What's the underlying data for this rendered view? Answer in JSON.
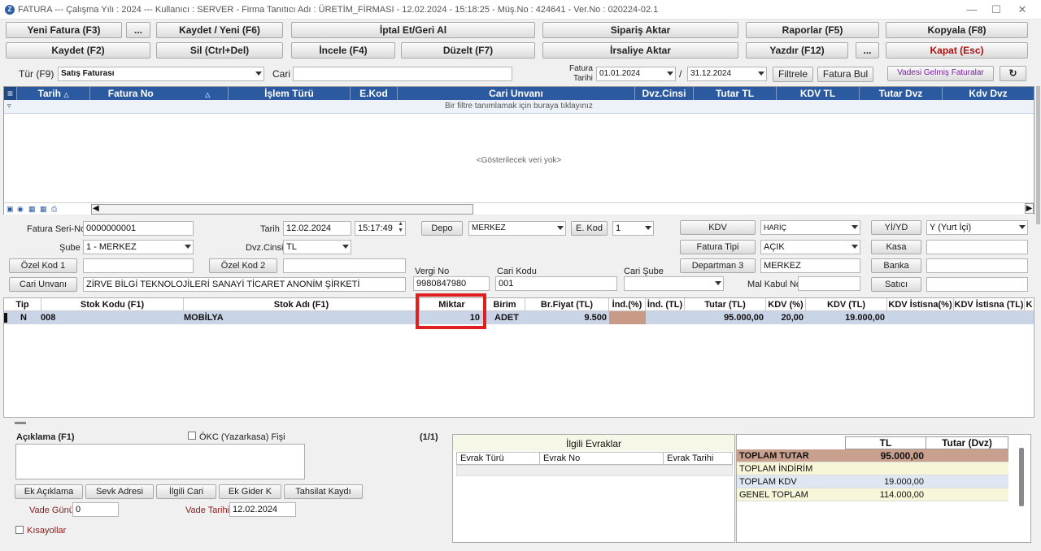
{
  "window": {
    "title": "FATURA  ---  Çalışma Yılı : 2024  ---  Kullanıcı : SERVER - Firma Tanıtıcı Adı : ÜRETİM_FİRMASI - 12.02.2024 - 15:18:25 - Müş.No : 424641 - Ver.No : 020224-02.1",
    "app_icon_letter": "Z"
  },
  "toolbar": {
    "yeni_fatura": "Yeni Fatura (F3)",
    "ellipsis1": "...",
    "kaydet_yeni": "Kaydet / Yeni (F6)",
    "iptal": "İptal Et/Geri Al",
    "siparis_aktar": "Sipariş Aktar",
    "raporlar": "Raporlar (F5)",
    "kopyala": "Kopyala (F8)",
    "kaydet": "Kaydet (F2)",
    "sil": "Sil (Ctrl+Del)",
    "incele": "İncele (F4)",
    "duzelt": "Düzelt (F7)",
    "irsaliye_aktar": "İrsaliye Aktar",
    "yazdir": "Yazdır (F12)",
    "ellipsis2": "...",
    "kapat": "Kapat (Esc)"
  },
  "filter": {
    "tur_label": "Tür (F9)",
    "tur_value": "Satış Faturası",
    "cari_label": "Cari",
    "cari_value": "",
    "fatura_tarihi_label1": "Fatura",
    "fatura_tarihi_label2": "Tarihi",
    "date_from": "01.01.2024",
    "date_sep": "/",
    "date_to": "31.12.2024",
    "filtrele": "Filtrele",
    "fatura_bul": "Fatura Bul",
    "vadesi_gelmis": "Vadesi Gelmiş Faturalar",
    "refresh_icon": "refresh-icon"
  },
  "invoice_grid": {
    "columns": [
      "Tarih",
      "Fatura No",
      "İşlem Türü",
      "E.Kod",
      "Cari Unvanı",
      "Dvz.Cinsi",
      "Tutar TL",
      "KDV TL",
      "Tutar Dvz",
      "Kdv Dvz"
    ],
    "filter_hint": "Bir filtre tanımlamak için buraya tıklayınız",
    "empty_text": "<Gösterilecek veri yok>"
  },
  "form": {
    "fatura_seri_no_label": "Fatura Seri-No",
    "fatura_seri_no": "0000000001",
    "tarih_label": "Tarih",
    "tarih": "12.02.2024",
    "saat": "15:17:49",
    "depo_btn": "Depo",
    "depo_value": "MERKEZ",
    "ekod_btn": "E. Kod",
    "ekod_value": "1",
    "kdv_btn": "KDV",
    "kdv_value": "HARİÇ",
    "yiyd_btn": "Yİ/YD",
    "yiyd_value": "Y (Yurt İçi)",
    "sube_label": "Şube",
    "sube_value": "1 - MERKEZ",
    "dvz_label": "Dvz.Cinsi",
    "dvz_value": "TL",
    "fatura_tipi_btn": "Fatura Tipi",
    "fatura_tipi_value": "AÇIK",
    "kasa_btn": "Kasa",
    "kasa_value": "",
    "ozel_kod1_btn": "Özel Kod 1",
    "ozel_kod1_value": "",
    "ozel_kod2_btn": "Özel Kod 2",
    "ozel_kod2_value": "",
    "departman_btn": "Departman 3",
    "departman_value": "MERKEZ",
    "banka_btn": "Banka",
    "banka_value": "",
    "vergi_no_label": "Vergi No",
    "vergi_no": "9980847980",
    "cari_kodu_label": "Cari Kodu",
    "cari_kodu": "001",
    "cari_sube_label": "Cari Şube",
    "cari_sube_value": "",
    "cari_unvani_btn": "Cari Unvanı",
    "cari_unvani": "ZİRVE BİLGİ TEKNOLOJİLERİ SANAYİ TİCARET ANONİM ŞİRKETİ",
    "mal_kabul_label": "Mal Kabul No",
    "mal_kabul_value": "",
    "satici_btn": "Satıcı",
    "satici_value": ""
  },
  "line_grid": {
    "columns": [
      "Tip",
      "Stok Kodu (F1)",
      "Stok Adı (F1)",
      "Miktar",
      "Birim",
      "Br.Fiyat (TL)",
      "İnd.(%)",
      "İnd. (TL)",
      "Tutar (TL)",
      "KDV (%)",
      "KDV (TL)",
      "KDV İstisna(%)",
      "KDV İstisna (TL)",
      "K"
    ],
    "rows": [
      {
        "tip": "N",
        "stok_kodu": "008",
        "stok_adi": "MOBİLYA",
        "miktar": "10",
        "birim": "ADET",
        "br_fiyat": "9.500",
        "ind_pct": "",
        "ind_tl": "",
        "tutar": "95.000,00",
        "kdv_pct": "20,00",
        "kdv_tl": "19.000,00",
        "kdv_ist_pct": "",
        "kdv_ist_tl": ""
      }
    ],
    "highlight_color": "#e02020"
  },
  "bottom": {
    "aciklama_label": "Açıklama (F1)",
    "okc_label": "ÖKC (Yazarkasa) Fişi",
    "page_counter": "(1/1)",
    "ek_aciklama": "Ek Açıklama",
    "sevk_adresi": "Sevk Adresi",
    "ilgili_cari": "İlgili Cari",
    "ek_gider": "Ek Gider K",
    "tahsilat_kaydi": "Tahsilat Kaydı",
    "vade_gunu_label": "Vade Günü",
    "vade_gunu": "0",
    "vade_tarihi_label": "Vade Tarihi",
    "vade_tarihi": "12.02.2024",
    "kisayollar_label": "Kısayollar"
  },
  "ilgili_evraklar": {
    "title": "İlgili Evraklar",
    "columns": [
      "Evrak Türü",
      "Evrak No",
      "Evrak Tarihi"
    ]
  },
  "totals": {
    "header_tl": "TL",
    "header_dvz": "Tutar (Dvz)",
    "rows": [
      {
        "label": "TOPLAM TUTAR",
        "tl": "95.000,00",
        "dvz": ""
      },
      {
        "label": "TOPLAM İNDİRİM",
        "tl": "",
        "dvz": ""
      },
      {
        "label": "TOPLAM KDV",
        "tl": "19.000,00",
        "dvz": ""
      },
      {
        "label": "GENEL TOPLAM",
        "tl": "114.000,00",
        "dvz": ""
      }
    ]
  }
}
